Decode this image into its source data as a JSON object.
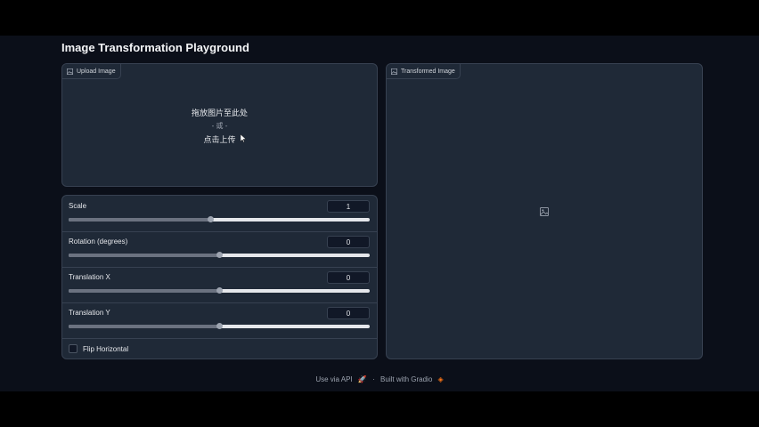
{
  "page": {
    "title": "Image Transformation Playground"
  },
  "upload": {
    "label": "Upload Image",
    "drop_line1": "拖放图片至此处",
    "drop_line2": "- 或 -",
    "drop_line3": "点击上传"
  },
  "output": {
    "label": "Transformed Image",
    "placeholder_icon": "image-icon"
  },
  "controls": [
    {
      "label": "Scale",
      "value": "1",
      "fraction": 0.47
    },
    {
      "label": "Rotation (degrees)",
      "value": "0",
      "fraction": 0.5
    },
    {
      "label": "Translation X",
      "value": "0",
      "fraction": 0.5
    },
    {
      "label": "Translation Y",
      "value": "0",
      "fraction": 0.5
    }
  ],
  "flip": {
    "label": "Flip Horizontal",
    "checked": false
  },
  "footer": {
    "api": "Use via API",
    "sep": "·",
    "built": "Built with Gradio"
  }
}
